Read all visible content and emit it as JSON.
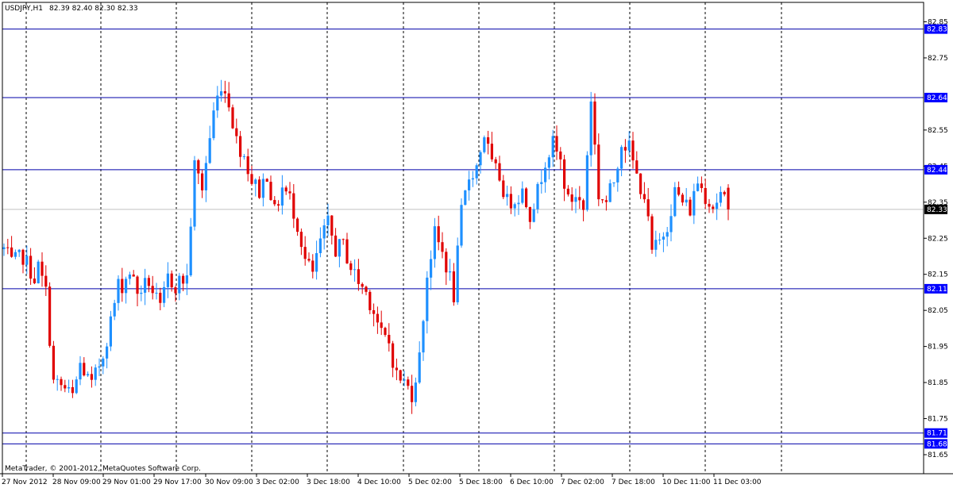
{
  "chart_header": {
    "symbol": "USDJPY,H1",
    "ohlc": "82.39 82.40 82.30 82.33"
  },
  "copyright": "MetaTrader, © 2001-2012, MetaQuotes Software Corp.",
  "colors": {
    "background": "#ffffff",
    "bull": "#1e90ff",
    "bear": "#e00000",
    "level_line": "#0000aa",
    "level_label_bg": "#0000ff",
    "current_price_line": "#c0c0c0",
    "current_price_label_bg": "#000000",
    "grid": "#000000"
  },
  "chart_data": {
    "type": "candlestick",
    "title": "USDJPY,H1",
    "ylim": [
      81.62,
      82.88
    ],
    "y_ticks": [
      "82.85",
      "82.75",
      "82.55",
      "82.45",
      "82.35",
      "82.25",
      "82.15",
      "82.05",
      "81.95",
      "81.85",
      "81.75",
      "81.65"
    ],
    "x_ticks": [
      "27 Nov 2012",
      "28 Nov 09:00",
      "29 Nov 01:00",
      "29 Nov 17:00",
      "30 Nov 09:00",
      "3 Dec 02:00",
      "3 Dec 18:00",
      "4 Dec 10:00",
      "5 Dec 02:00",
      "5 Dec 18:00",
      "6 Dec 10:00",
      "7 Dec 02:00",
      "7 Dec 18:00",
      "10 Dec 11:00",
      "11 Dec 03:00"
    ],
    "grid": "vertical dashed",
    "horizontal_levels": [
      "82.83",
      "82.64",
      "82.44",
      "82.11",
      "81.71",
      "81.68"
    ],
    "current_price": "82.33",
    "close_path": [
      [
        0,
        82.22
      ],
      [
        2,
        82.18
      ],
      [
        5,
        82.2
      ],
      [
        8,
        82.14
      ],
      [
        9,
        82.17
      ],
      [
        11,
        82.1
      ],
      [
        13,
        81.85
      ],
      [
        15,
        81.84
      ],
      [
        18,
        81.81
      ],
      [
        20,
        81.9
      ],
      [
        23,
        81.84
      ],
      [
        26,
        81.93
      ],
      [
        28,
        82.02
      ],
      [
        30,
        82.12
      ],
      [
        31,
        82.12
      ],
      [
        33,
        82.16
      ],
      [
        35,
        82.1
      ],
      [
        38,
        82.13
      ],
      [
        41,
        82.05
      ],
      [
        43,
        82.14
      ],
      [
        45,
        82.12
      ],
      [
        46,
        82.13
      ],
      [
        48,
        82.14
      ],
      [
        50,
        82.45
      ],
      [
        52,
        82.39
      ],
      [
        55,
        82.6
      ],
      [
        57,
        82.68
      ],
      [
        59,
        82.63
      ],
      [
        61,
        82.52
      ],
      [
        63,
        82.48
      ],
      [
        65,
        82.41
      ],
      [
        67,
        82.38
      ],
      [
        69,
        82.43
      ],
      [
        71,
        82.32
      ],
      [
        73,
        82.39
      ],
      [
        75,
        82.36
      ],
      [
        77,
        82.29
      ],
      [
        79,
        82.19
      ],
      [
        81,
        82.15
      ],
      [
        83,
        82.24
      ],
      [
        85,
        82.29
      ],
      [
        87,
        82.22
      ],
      [
        89,
        82.23
      ],
      [
        91,
        82.17
      ],
      [
        93,
        82.13
      ],
      [
        95,
        82.1
      ],
      [
        97,
        82.05
      ],
      [
        99,
        81.98
      ],
      [
        101,
        81.96
      ],
      [
        103,
        81.87
      ],
      [
        105,
        81.85
      ],
      [
        107,
        81.82
      ],
      [
        109,
        81.92
      ],
      [
        111,
        82.15
      ],
      [
        113,
        82.26
      ],
      [
        115,
        82.21
      ],
      [
        117,
        82.14
      ],
      [
        118,
        82.09
      ],
      [
        120,
        82.32
      ],
      [
        122,
        82.42
      ],
      [
        124,
        82.45
      ],
      [
        126,
        82.54
      ],
      [
        128,
        82.45
      ],
      [
        130,
        82.42
      ],
      [
        132,
        82.35
      ],
      [
        134,
        82.36
      ],
      [
        136,
        82.38
      ],
      [
        138,
        82.32
      ],
      [
        140,
        82.38
      ],
      [
        142,
        82.47
      ],
      [
        144,
        82.51
      ],
      [
        146,
        82.46
      ],
      [
        148,
        82.35
      ],
      [
        150,
        82.37
      ],
      [
        152,
        82.33
      ],
      [
        154,
        82.64
      ],
      [
        156,
        82.37
      ],
      [
        158,
        82.35
      ],
      [
        160,
        82.41
      ],
      [
        162,
        82.52
      ],
      [
        164,
        82.5
      ],
      [
        166,
        82.42
      ],
      [
        168,
        82.37
      ],
      [
        170,
        82.21
      ],
      [
        172,
        82.24
      ],
      [
        174,
        82.29
      ],
      [
        176,
        82.38
      ],
      [
        178,
        82.35
      ],
      [
        180,
        82.33
      ],
      [
        182,
        82.41
      ],
      [
        184,
        82.37
      ],
      [
        186,
        82.34
      ],
      [
        188,
        82.37
      ],
      [
        190,
        82.33
      ]
    ]
  }
}
